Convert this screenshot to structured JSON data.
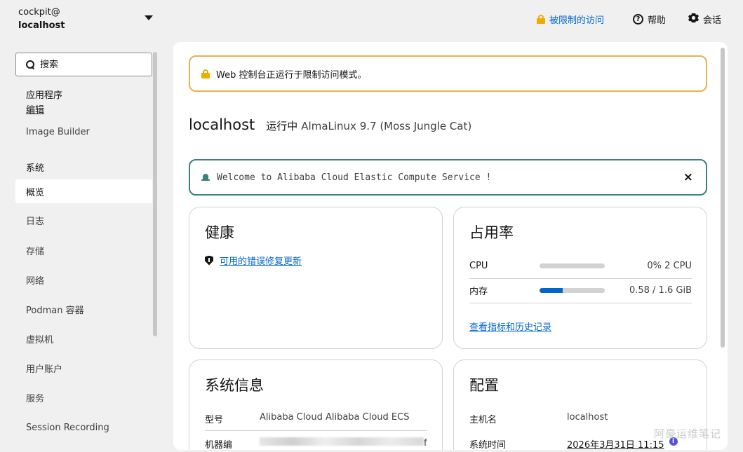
{
  "header": {
    "user": "cockpit@",
    "host": "localhost",
    "limited_access": "被限制的访问",
    "help": "帮助",
    "session": "会话"
  },
  "sidebar": {
    "search_placeholder": "搜索",
    "apps_group": "应用程序",
    "edit_link": "编辑",
    "image_builder": "Image Builder",
    "system_group": "系统",
    "items": [
      {
        "label": "概览",
        "active": true
      },
      {
        "label": "日志"
      },
      {
        "label": "存储"
      },
      {
        "label": "网络"
      },
      {
        "label": "Podman 容器"
      },
      {
        "label": "虚拟机"
      },
      {
        "label": "用户账户"
      },
      {
        "label": "服务"
      },
      {
        "label": "Session Recording"
      }
    ]
  },
  "main": {
    "restricted_alert": "Web 控制台正运行于限制访问模式。",
    "title_host": "localhost",
    "title_status": "运行中",
    "title_os": "AlmaLinux 9.7 (Moss Jungle Cat)",
    "motd": "Welcome to Alibaba Cloud Elastic Compute Service !",
    "motd_close": "×"
  },
  "health": {
    "title": "健康",
    "updates_link": "可用的错误修复更新"
  },
  "usage": {
    "title": "占用率",
    "cpu_label": "CPU",
    "cpu_value": "0% 2 CPU",
    "cpu_fraction": 0.0,
    "memory_label": "内存",
    "memory_value": "0.58 / 1.6 GiB",
    "memory_fraction": 0.36,
    "metrics_link": "查看指标和历史记录"
  },
  "system_info": {
    "title": "系统信息",
    "model_label": "型号",
    "model_value": "Alibaba Cloud Alibaba Cloud ECS",
    "machine_id_label": "机器编",
    "machine_id_tail": "f"
  },
  "configuration": {
    "title": "配置",
    "hostname_label": "主机名",
    "hostname_value": "localhost",
    "time_label": "系统时间",
    "time_value": "2026年3月31日 11:15"
  },
  "watermark": "阿豪运维笔记",
  "colors": {
    "accent": "#0066cc",
    "warning": "#f0ab00",
    "warning_border": "#e6b34b",
    "info_border": "#3c7f7d",
    "info_dot": "#5752d1"
  }
}
